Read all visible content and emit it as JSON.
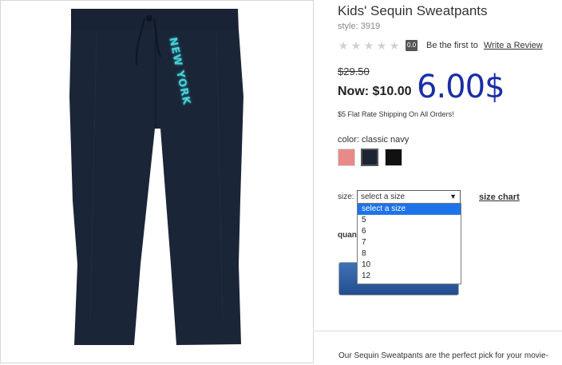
{
  "product": {
    "title": "Kids' Sequin Sweatpants",
    "style": "style: 3919",
    "image_text": "NEW YORK"
  },
  "rating": {
    "stars": 0,
    "score": "0.0",
    "prompt": "Be the first to",
    "link": "Write a Review"
  },
  "price": {
    "old": "$29.50",
    "now": "Now: $10.00",
    "handwritten": "6.00$",
    "shipping": "$5 Flat Rate Shipping On All Orders!"
  },
  "color": {
    "label": "color: classic navy",
    "swatches": [
      "#e98a8a",
      "#1d2433",
      "#111111"
    ]
  },
  "size": {
    "label": "size:",
    "selected": "select a size",
    "chart_link": "size chart",
    "options": [
      "select a size",
      "5",
      "6",
      "7",
      "8",
      "10",
      "12"
    ]
  },
  "quantity": {
    "label": "quan"
  },
  "description": "Our Sequin Sweatpants are the perfect pick for your movie-"
}
